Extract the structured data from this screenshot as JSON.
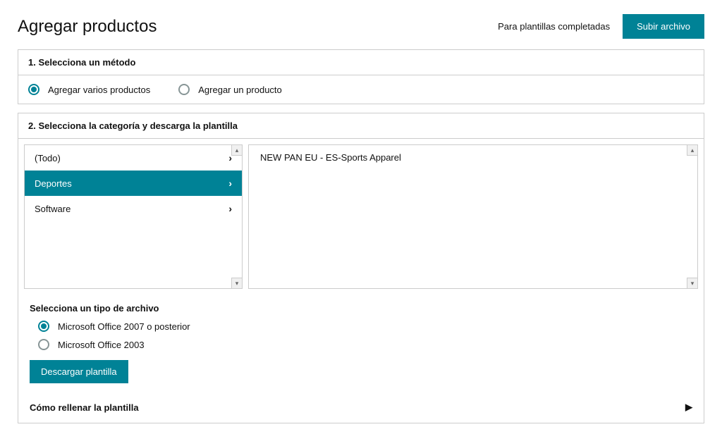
{
  "header": {
    "title": "Agregar productos",
    "link": "Para plantillas completadas",
    "upload_button": "Subir archivo"
  },
  "step1": {
    "title": "1. Selecciona un método",
    "options": [
      {
        "label": "Agregar varios productos",
        "selected": true
      },
      {
        "label": "Agregar un producto",
        "selected": false
      }
    ]
  },
  "step2": {
    "title": "2. Selecciona la categoría y descarga la plantilla",
    "categories": [
      {
        "label": "(Todo)",
        "selected": false
      },
      {
        "label": "Deportes",
        "selected": true
      },
      {
        "label": "Software",
        "selected": false
      }
    ],
    "detail": "NEW PAN EU - ES-Sports Apparel",
    "file_type_title": "Selecciona un tipo de archivo",
    "file_types": [
      {
        "label": "Microsoft Office 2007 o posterior",
        "selected": true
      },
      {
        "label": "Microsoft Office 2003",
        "selected": false
      }
    ],
    "download_button": "Descargar plantilla"
  },
  "footer": {
    "help": "Cómo rellenar la plantilla"
  }
}
